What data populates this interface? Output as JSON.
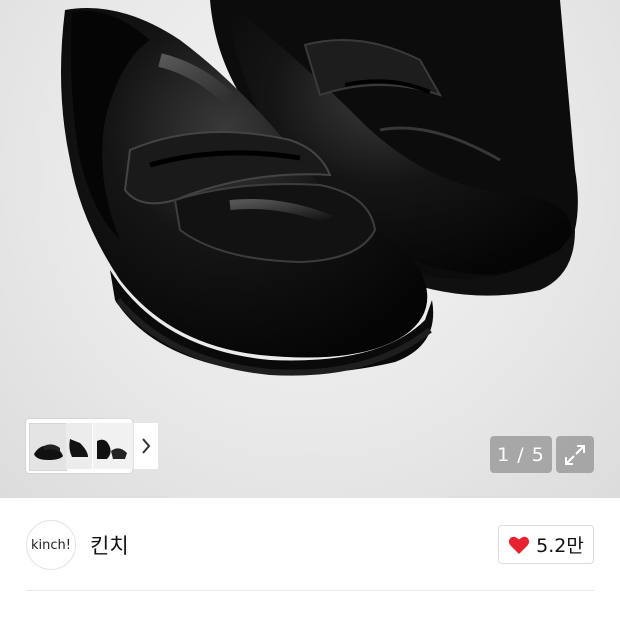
{
  "gallery": {
    "counter": "1 / 5",
    "image_subject": "black-leather-penny-loafers",
    "thumbnails": [
      "shoe-thumb-1",
      "shoe-thumb-2",
      "shoe-thumb-3"
    ],
    "next_icon": "chevron-right-icon",
    "expand_icon": "expand-arrows-icon"
  },
  "brand": {
    "logo_text": "kinch!",
    "name": "킨치"
  },
  "like": {
    "icon": "heart-icon",
    "color": "#e8232f",
    "count": "5.2만"
  }
}
